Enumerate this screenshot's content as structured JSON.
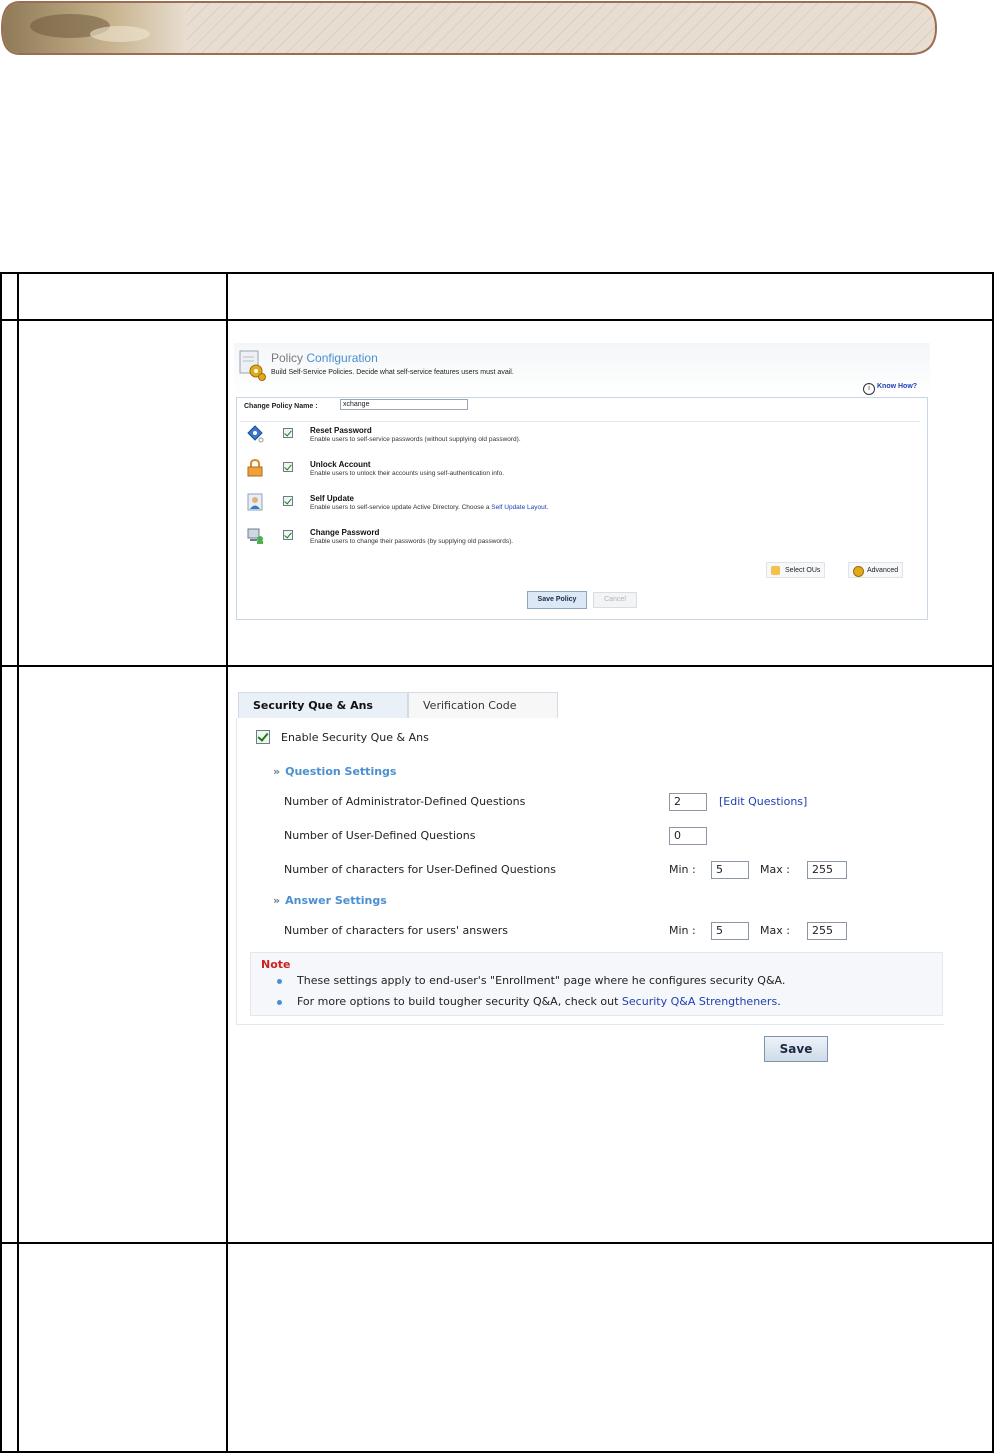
{
  "policy_configuration": {
    "title_plain": "Policy",
    "title_accent": "Configuration",
    "subtitle": "Build Self-Service Policies. Decide what self-service features users must avail.",
    "know_how": "Know How?",
    "policy_name_label": "Change Policy Name :",
    "policy_name_value": "xchange",
    "features": [
      {
        "title": "Reset Password",
        "description": "Enable users to self-service passwords (without supplying old password).",
        "checked": true,
        "icon": "key-icon"
      },
      {
        "title": "Unlock Account",
        "description": "Enable users to unlock their accounts using self-authentication info.",
        "checked": true,
        "icon": "lock-icon"
      },
      {
        "title": "Self Update",
        "description_prefix": "Enable users to self-service update Active Directory. Choose a ",
        "description_link": "Self Update Layout",
        "description_suffix": ".",
        "checked": true,
        "icon": "user-card-icon"
      },
      {
        "title": "Change Password",
        "description": "Enable users to change their passwords (by supplying old passwords).",
        "checked": true,
        "icon": "computer-user-icon"
      }
    ],
    "select_ous_label": "Select OUs",
    "advanced_label": "Advanced",
    "save_policy_label": "Save Policy",
    "cancel_label": "Cancel"
  },
  "security_qa": {
    "tabs": [
      {
        "label": "Security Que & Ans",
        "active": true
      },
      {
        "label": "Verification Code",
        "active": false
      }
    ],
    "enable_label": "Enable Security Que & Ans",
    "enable_checked": true,
    "question_settings_label": "Question Settings",
    "admin_questions_label": "Number of Administrator-Defined Questions",
    "admin_questions_value": "2",
    "edit_questions_label": "[Edit Questions]",
    "user_questions_label": "Number of User-Defined Questions",
    "user_questions_value": "0",
    "user_question_chars_label": "Number of characters for User-Defined Questions",
    "min_label": "Min :",
    "max_label": "Max :",
    "user_question_min": "5",
    "user_question_max": "255",
    "answer_settings_label": "Answer Settings",
    "answer_chars_label": "Number of characters for users' answers",
    "answer_min": "5",
    "answer_max": "255",
    "note_title": "Note",
    "note_line1": "These settings apply to end-user's \"Enrollment\" page where he configures security Q&A.",
    "note_line2_prefix": "For more options to build tougher security Q&A, check out ",
    "note_line2_link": "Security Q&A Strengtheners",
    "note_line2_suffix": ".",
    "save_label": "Save"
  },
  "colors": {
    "accent_blue": "#4a8fd0",
    "link_blue": "#1f3fb0",
    "note_red": "#d02020",
    "check_green": "#1e7a1e"
  }
}
